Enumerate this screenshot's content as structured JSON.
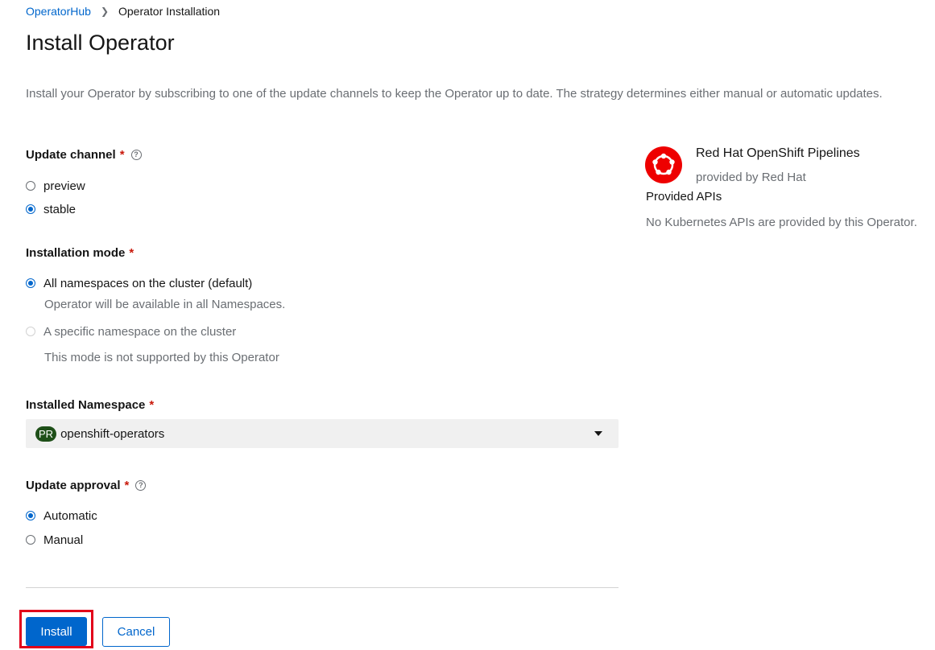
{
  "breadcrumb": {
    "parent": "OperatorHub",
    "current": "Operator Installation"
  },
  "page": {
    "title": "Install Operator",
    "description": "Install your Operator by subscribing to one of the update channels to keep the Operator up to date. The strategy determines either manual or automatic updates."
  },
  "update_channel": {
    "label": "Update channel",
    "required_mark": "*",
    "help_icon": "question-circle-icon",
    "options": [
      {
        "label": "preview",
        "checked": false
      },
      {
        "label": "stable",
        "checked": true
      }
    ]
  },
  "installation_mode": {
    "label": "Installation mode",
    "required_mark": "*",
    "options": [
      {
        "label": "All namespaces on the cluster (default)",
        "help": "Operator will be available in all Namespaces.",
        "checked": true,
        "disabled": false
      },
      {
        "label": "A specific namespace on the cluster",
        "help": "This mode is not supported by this Operator",
        "checked": false,
        "disabled": true
      }
    ]
  },
  "installed_namespace": {
    "label": "Installed Namespace",
    "required_mark": "*",
    "badge": "PR",
    "value": "openshift-operators"
  },
  "update_approval": {
    "label": "Update approval",
    "required_mark": "*",
    "help_icon": "question-circle-icon",
    "options": [
      {
        "label": "Automatic",
        "checked": true
      },
      {
        "label": "Manual",
        "checked": false
      }
    ]
  },
  "actions": {
    "install_label": "Install",
    "cancel_label": "Cancel"
  },
  "operator": {
    "name": "Red Hat OpenShift Pipelines",
    "provider": "provided by Red Hat",
    "logo_color": "#ee0000"
  },
  "provided_apis": {
    "title": "Provided APIs",
    "empty_text": "No Kubernetes APIs are provided by this Operator."
  },
  "colors": {
    "link": "#0066cc",
    "primary_button": "#0066cc",
    "required": "#c9190b",
    "highlight_box": "#e2001a",
    "namespace_badge": "#1e4f18"
  }
}
